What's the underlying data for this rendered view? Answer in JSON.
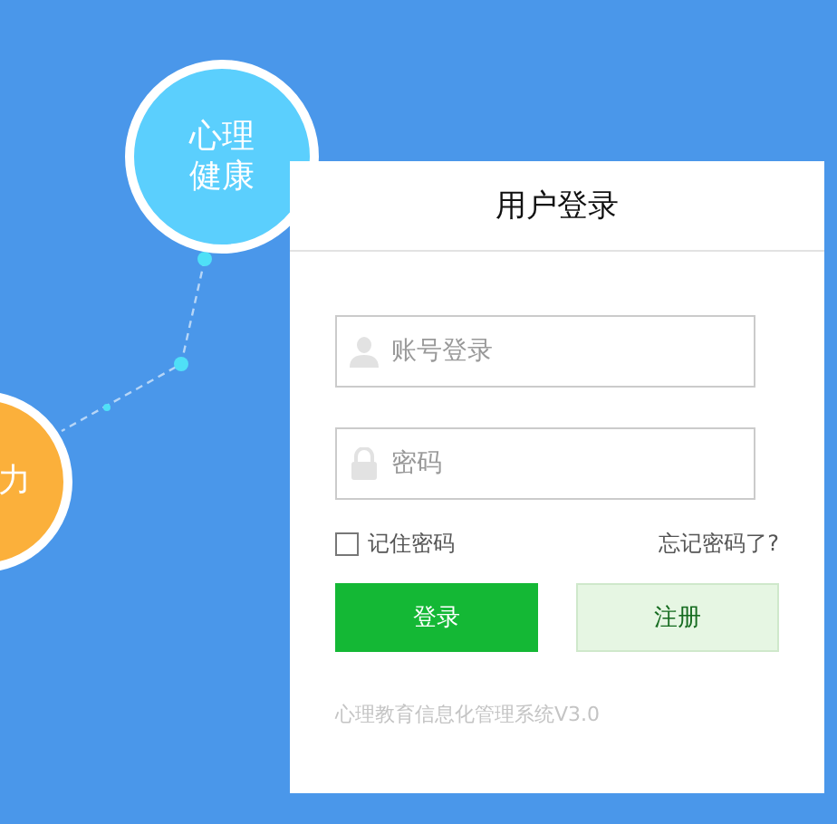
{
  "diagram": {
    "nodes": [
      {
        "label": "心理健康",
        "color": "#5bcffd"
      },
      {
        "label": "力",
        "color": "#fbb03b"
      }
    ]
  },
  "login": {
    "title": "用户登录",
    "fields": [
      {
        "kind": "user",
        "placeholder": "账号登录"
      },
      {
        "kind": "password",
        "placeholder": "密码"
      }
    ],
    "remember": {
      "label": "记住密码",
      "checked": false
    },
    "forgot": "忘记密码了?",
    "buttons": [
      {
        "kind": "primary",
        "label": "登录"
      },
      {
        "kind": "secondary",
        "label": "注册"
      }
    ],
    "footer": "心理教育信息化管理系统V3.0"
  }
}
